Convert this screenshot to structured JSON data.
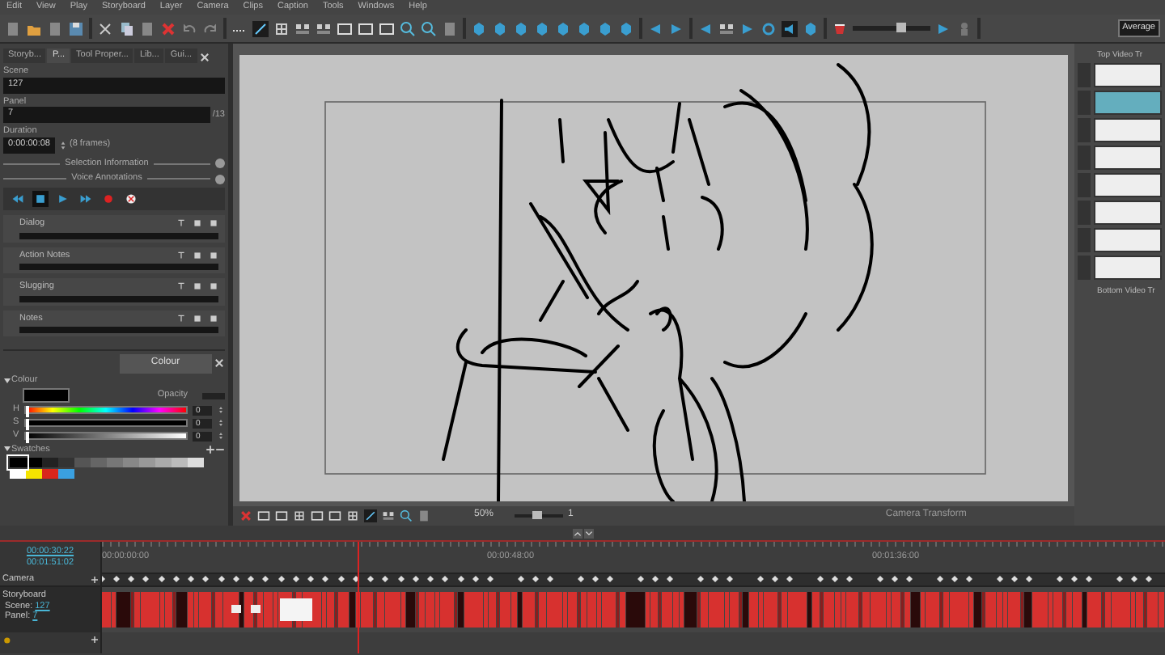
{
  "menu": [
    "Edit",
    "View",
    "Play",
    "Storyboard",
    "Layer",
    "Camera",
    "Clips",
    "Caption",
    "Tools",
    "Windows",
    "Help"
  ],
  "toolbar": {
    "volume_slider": {
      "level": 0.65
    },
    "mode_field": "Average"
  },
  "left_panel": {
    "tabs": [
      {
        "label": "Storyb...",
        "selected": false
      },
      {
        "label": "P...",
        "selected": true
      },
      {
        "label": "Tool Proper...",
        "selected": false
      },
      {
        "label": "Lib...",
        "selected": false
      },
      {
        "label": "Gui...",
        "selected": false
      }
    ],
    "scene": {
      "label": "Scene",
      "value": "127"
    },
    "panel": {
      "label": "Panel",
      "value": "7",
      "total": "/13"
    },
    "duration": {
      "label": "Duration",
      "value": "0:00:00:08",
      "frames": "(8 frames)"
    },
    "sections": [
      "Selection Information",
      "Voice Annotations"
    ],
    "voice_buttons": [
      {
        "kind": "rewind",
        "selected": false
      },
      {
        "kind": "stop",
        "selected": true
      },
      {
        "kind": "play",
        "selected": false
      },
      {
        "kind": "forward",
        "selected": false
      },
      {
        "kind": "record",
        "selected": false
      },
      {
        "kind": "delete",
        "selected": false
      }
    ],
    "notes": [
      "Dialog",
      "Action Notes",
      "Slugging",
      "Notes"
    ]
  },
  "colour_panel": {
    "tab": "Colour",
    "title": "Colour",
    "current": {
      "color": "#000000"
    },
    "opacity_label": "Opacity",
    "channels": [
      {
        "label": "H",
        "kind": "hue",
        "level": 0,
        "value": "0"
      },
      {
        "label": "S",
        "kind": "saturation",
        "level": 0,
        "value": "0"
      },
      {
        "label": "V",
        "kind": "value",
        "level": 0,
        "value": "0"
      }
    ],
    "swatches_title": "Swatches",
    "swatches": [
      {
        "color": "#000000",
        "selected": true
      },
      {
        "color": "#000000",
        "selected": false
      },
      {
        "color": "#222222",
        "selected": false
      },
      {
        "color": "#333333",
        "selected": false
      },
      {
        "color": "#555555",
        "selected": false
      },
      {
        "color": "#666666",
        "selected": false
      },
      {
        "color": "#777777",
        "selected": false
      },
      {
        "color": "#888888",
        "selected": false
      },
      {
        "color": "#999999",
        "selected": false
      },
      {
        "color": "#aaaaaa",
        "selected": false
      },
      {
        "color": "#bbbbbb",
        "selected": false
      },
      {
        "color": "#dddddd",
        "selected": false
      },
      {
        "color": "#ffffff",
        "selected": false
      },
      {
        "color": "#f5e400",
        "selected": false
      },
      {
        "color": "#d9261c",
        "selected": false
      },
      {
        "color": "#3aa0e0",
        "selected": false
      }
    ]
  },
  "canvas_toolbar": {
    "zoom": "50%",
    "zoom_slider": {
      "level": 0.45
    },
    "value": "1",
    "status": "Camera Transform"
  },
  "right_panel": {
    "top_title": "Top Video Tr",
    "thumbnails": [
      {
        "selected": false
      },
      {
        "selected": true
      },
      {
        "selected": false
      },
      {
        "selected": false
      },
      {
        "selected": false
      },
      {
        "selected": false
      },
      {
        "selected": false
      },
      {
        "selected": false
      }
    ],
    "bottom_title": "Bottom Video Tr"
  },
  "timeline": {
    "current_time": "00:00:30:22",
    "total_time": "00:01:51:02",
    "ruler": [
      "00:00:00:00",
      "00:00:48:00",
      "00:01:36:00"
    ],
    "playhead": {
      "level": 0.24
    },
    "tracks": [
      {
        "kind": "camera",
        "name": "Camera"
      },
      {
        "kind": "storyboard",
        "name": "Storyboard",
        "scene_label": "Scene:",
        "scene": "127",
        "panel_label": "Panel:",
        "panel": "7"
      }
    ]
  }
}
